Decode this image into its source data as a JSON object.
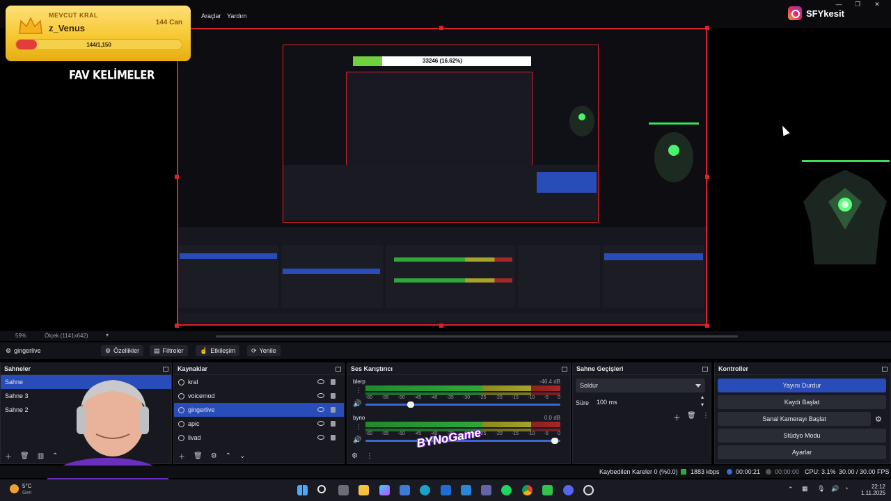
{
  "menubar": {
    "items": [
      "Araçlar",
      "Yardım"
    ]
  },
  "overlay": {
    "king_label": "MEVCUT KRAL",
    "king_name": "z_Venus",
    "king_hp": "144 Can",
    "king_progress_text": "144/1,150",
    "king_progress": 0.125,
    "fav_title": "FAV KELİMELER",
    "instagram_handle": "SFYkesit",
    "inner_counter": "33246 (16.62%)"
  },
  "preview": {
    "zoom": "59%",
    "scale_label": "Ölçek (1141x642)"
  },
  "toolbar": {
    "source_name": "gingerlive",
    "properties": "Özellikler",
    "filters": "Filtreler",
    "interact": "Etkileşim",
    "refresh": "Yenile"
  },
  "scenes": {
    "title": "Sahneler",
    "items": [
      "Sahne",
      "Sahne 3",
      "Sahne 2"
    ],
    "selected": 0
  },
  "sources": {
    "title": "Kaynaklar",
    "items": [
      "kral",
      "voicemod",
      "gingerlive",
      "apic",
      "livad"
    ],
    "selected": 2
  },
  "mixer": {
    "title": "Ses Karıştırıcı",
    "channels": [
      {
        "name": "blerp",
        "db": "-46.4 dB",
        "volume": 0.25
      },
      {
        "name": "byno",
        "db": "0.0 dB",
        "volume": 0.99
      }
    ],
    "ticks": [
      "-60",
      "-55",
      "-50",
      "-45",
      "-40",
      "-35",
      "-30",
      "-25",
      "-20",
      "-15",
      "-10",
      "-5",
      "0"
    ]
  },
  "transitions": {
    "title": "Sahne Geçişleri",
    "selected": "Soldur",
    "duration_label": "Süre",
    "duration": "100 ms"
  },
  "controls": {
    "title": "Kontroller",
    "buttons": [
      "Yayını Durdur",
      "Kaydı Başlat",
      "Sanal Kamerayı Başlat",
      "Stüdyo Modu",
      "Ayarlar"
    ]
  },
  "status": {
    "dropped": "Kaybedilen Kareler 0 (%0.0)",
    "bitrate": "1883 kbps",
    "stream_time": "00:00:21",
    "rec_time": "00:00:00",
    "cpu": "CPU: 3.1%",
    "fps": "30.00 / 30.00 FPS"
  },
  "taskbar": {
    "weather_temp": "5°C",
    "weather_desc": "Gen",
    "time": "22:12",
    "date": "1.11.2025"
  },
  "watermark": "BYNoGame",
  "colors": {
    "accent": "#284cb8",
    "record_border": "#e0202a",
    "king_gold": "#f7c832",
    "meter_green": "#2fa83a",
    "meter_yellow": "#a6a22a",
    "meter_red": "#a52828"
  }
}
